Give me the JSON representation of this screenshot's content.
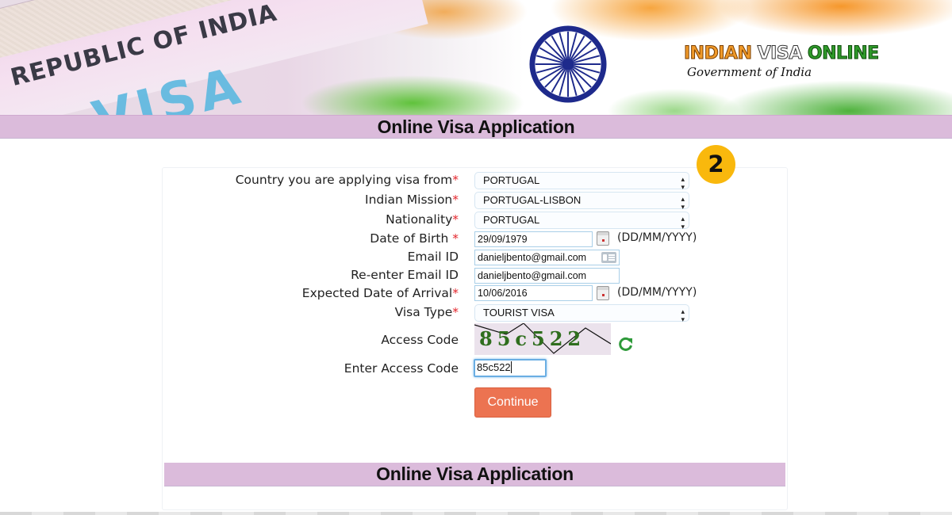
{
  "banner": {
    "passport_text": "REPUBLIC OF INDIA",
    "passport_visa": "VISA",
    "logo_word1": "INDIAN",
    "logo_word2": "VISA",
    "logo_word3": "ONLINE",
    "logo_subtitle": "Government of India",
    "emblem": "ashoka-chakra-icon",
    "colors": {
      "saffron": "#f09a2a",
      "green": "#2f9a2a",
      "navy": "#1e2a8c"
    }
  },
  "header": {
    "title": "Online Visa Application"
  },
  "step_badge": {
    "number": "2",
    "color": "#f9b80d"
  },
  "form": {
    "required_marker": "*",
    "country": {
      "label": "Country you are applying visa from",
      "value": "PORTUGAL"
    },
    "mission": {
      "label": "Indian Mission",
      "value": "PORTUGAL-LISBON"
    },
    "nationality": {
      "label": "Nationality",
      "value": "PORTUGAL"
    },
    "dob": {
      "label": "Date of Birth ",
      "value": "29/09/1979",
      "hint": "(DD/MM/YYYY)"
    },
    "email": {
      "label": "Email ID",
      "value": "danieljbento@gmail.com"
    },
    "email_confirm": {
      "label": "Re-enter Email ID",
      "value": "danieljbento@gmail.com"
    },
    "arrival": {
      "label": "Expected Date of Arrival",
      "value": "10/06/2016",
      "hint": "(DD/MM/YYYY)"
    },
    "visa_type": {
      "label": "Visa Type",
      "value": "TOURIST VISA"
    },
    "access_code": {
      "label": "Access Code",
      "captcha_text": "85c522"
    },
    "enter_access_code": {
      "label": "Enter Access Code",
      "value": "85c522"
    },
    "continue_label": "Continue",
    "continue_color": "#ec7351"
  },
  "footer": {
    "title": "Online Visa Application"
  },
  "select_arrows": "▲▼"
}
